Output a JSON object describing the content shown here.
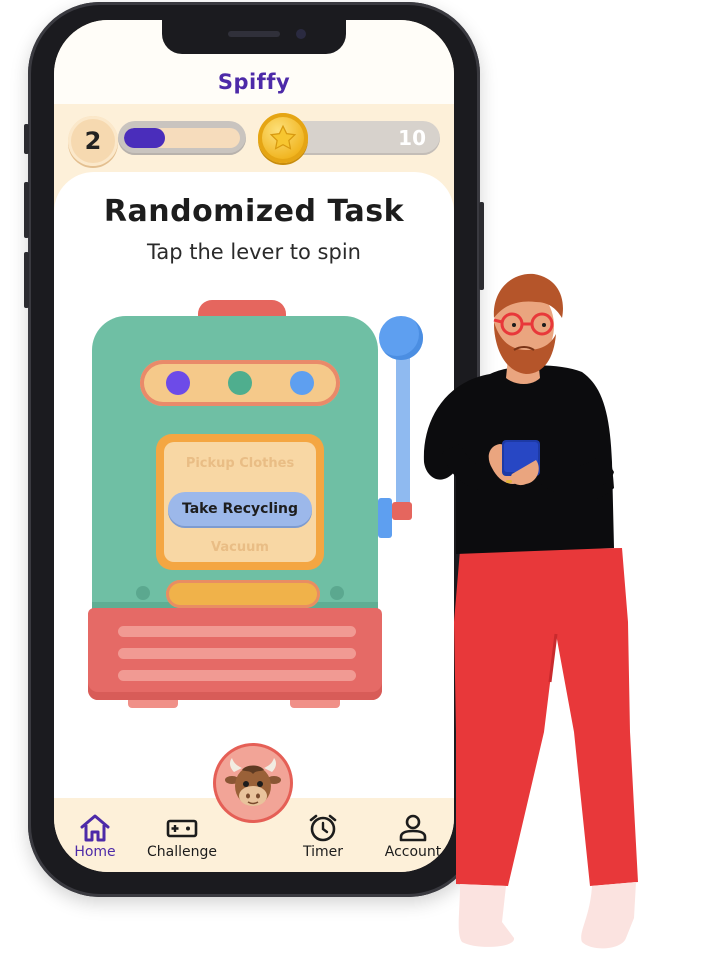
{
  "app": {
    "title": "Spiffy"
  },
  "stats": {
    "level": "2",
    "xp_progress": 0.35,
    "coins": "10",
    "coin_icon": "star-coin-icon"
  },
  "task": {
    "title": "Randomized Task",
    "subtitle": "Tap the lever to spin",
    "reel": {
      "above": "Pickup Clothes",
      "selected": "Take Recycling",
      "below": "Vacuum"
    }
  },
  "colors": {
    "brand": "#4d2aa8",
    "machine_green": "#6fbfa4",
    "machine_red": "#e56a66",
    "lever_blue": "#5e9ff0",
    "selected_pill": "#9cb8ea"
  },
  "nav": {
    "items": [
      {
        "label": "Home",
        "icon": "home-icon",
        "active": true
      },
      {
        "label": "Challenge",
        "icon": "gamepad-icon",
        "active": false
      },
      {
        "label": "Timer",
        "icon": "alarm-clock-icon",
        "active": false
      },
      {
        "label": "Account",
        "icon": "user-icon",
        "active": false
      }
    ],
    "center_icon": "cow-mascot-icon"
  }
}
